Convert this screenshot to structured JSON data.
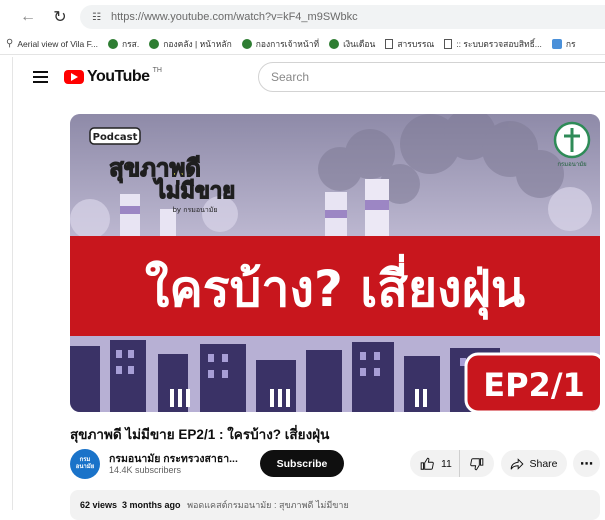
{
  "browser": {
    "url": "https://www.youtube.com/watch?v=kF4_m9SWbkc",
    "back_icon": "arrow-left-icon",
    "reload_icon": "reload-icon",
    "site_info_icon": "site-info-icon"
  },
  "bookmarks": [
    {
      "label": "Aerial view of Vila F...",
      "icon": "search-icon"
    },
    {
      "label": "กรส.",
      "icon": "green-circle-icon"
    },
    {
      "label": "กองคลัง | หน้าหลัก",
      "icon": "green-circle-icon"
    },
    {
      "label": "กองการเจ้าหน้าที่",
      "icon": "green-circle-icon"
    },
    {
      "label": "เงินเดือน",
      "icon": "green-circle-icon"
    },
    {
      "label": "สารบรรณ",
      "icon": "document-icon"
    },
    {
      "label": ":: ระบบตรวจสอบสิทธิ์...",
      "icon": "document-icon"
    },
    {
      "label": "กร",
      "icon": "image-icon"
    }
  ],
  "youtube": {
    "logo_text": "YouTube",
    "logo_region": "TH",
    "search_placeholder": "Search"
  },
  "thumbnail": {
    "badge": "Podcast",
    "show_name_line1": "สุขภาพดี",
    "show_name_line2": "ไม่มีขาย",
    "show_tagline": "by กรมอนามัย",
    "headline": "ใครบ้าง? เสี่ยงฝุ่น",
    "episode": "EP2/1",
    "org_logo_label": "กรมอนามัย"
  },
  "video": {
    "title": "สุขภาพดี ไม่มีขาย EP2/1 : ใครบ้าง? เสี่ยงฝุ่น"
  },
  "owner": {
    "avatar_text_line1": "กรม",
    "avatar_text_line2": "อนามัย",
    "channel_name": "กรมอนามัย กระทรวงสาธา...",
    "subscribers": "14.4K subscribers",
    "subscribe_label": "Subscribe"
  },
  "actions": {
    "like_count": "11",
    "share_label": "Share",
    "more_label": "⋯"
  },
  "description": {
    "views": "62 views",
    "age": "3 months ago",
    "tags": "พอดแคสต์กรมอนามัย : สุขภาพดี ไม่มีขาย"
  },
  "colors": {
    "yt_red": "#ff0000",
    "banner_red": "#c8161d",
    "subscribe_bg": "#0f0f0f",
    "sky": "#b9b4cf"
  }
}
